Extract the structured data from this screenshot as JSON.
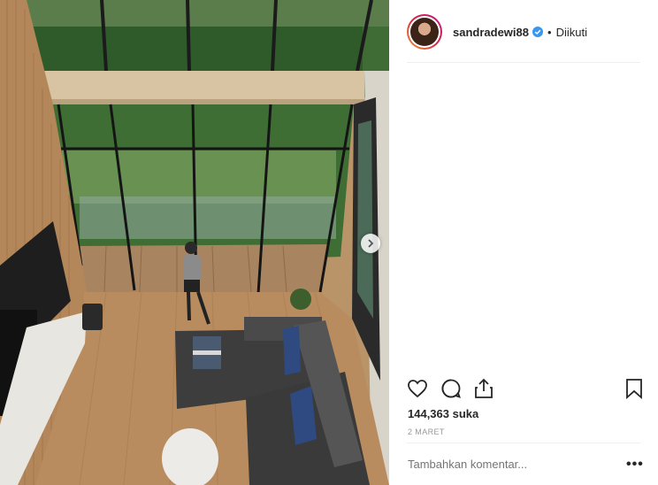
{
  "post": {
    "username": "sandradewi88",
    "separator": "•",
    "follow_status": "Diikuti",
    "likes": "144,363 suka",
    "date": "2 MARET",
    "comment_placeholder": "Tambahkan komentar...",
    "more_options": "•••"
  },
  "icons": {
    "verified": "verified-badge-icon",
    "like": "heart-icon",
    "comment": "comment-icon",
    "share": "share-icon",
    "save": "bookmark-icon",
    "next": "chevron-right-icon"
  },
  "colors": {
    "verified_blue": "#3897f0",
    "text": "#262626",
    "muted": "#999999"
  }
}
